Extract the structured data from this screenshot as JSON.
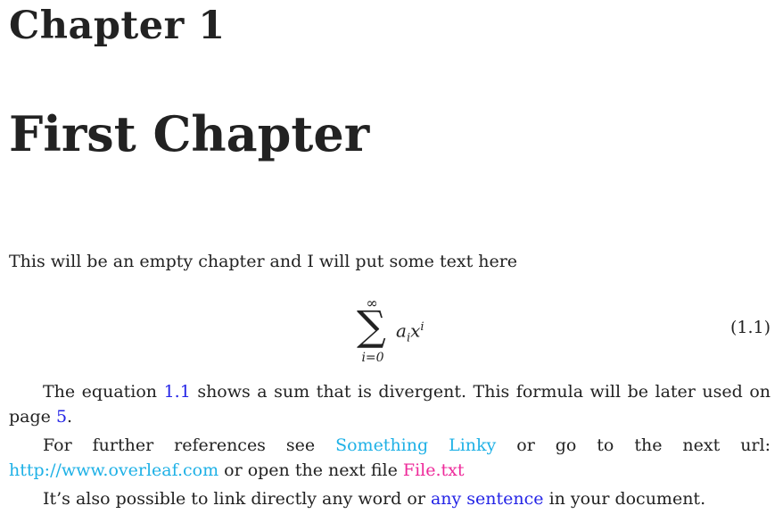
{
  "chapter": {
    "label": "Chapter 1",
    "title": "First Chapter"
  },
  "intro": "This will be an empty chapter and I will put some text here",
  "equation": {
    "sum_sup": "∞",
    "sum_symbol": "∑",
    "sum_sub": "i=0",
    "term_a": "a",
    "term_a_sub": "i",
    "term_x": "x",
    "term_x_sup": "i",
    "number": "(1.1)"
  },
  "paragraph1": {
    "before": "The equation ",
    "link": "1.1",
    "middle": " shows a sum that is divergent. This formula will be later used on page ",
    "page_link": "5",
    "after": "."
  },
  "paragraph2": {
    "before": "For further references see ",
    "link_linky": "Something Linky",
    "middle": " or go to the next url: ",
    "link_url": "http://www.overleaf.com",
    "middle2": " or open the next file ",
    "link_file": "File.txt"
  },
  "paragraph3": {
    "before": "It’s also possible to link directly any word or ",
    "link": "any sentence",
    "after": " in your document."
  },
  "colors": {
    "internal_link": "#2424e6",
    "url_link": "#1fb1e6",
    "file_link": "#ee2a9a",
    "text": "#222222"
  }
}
